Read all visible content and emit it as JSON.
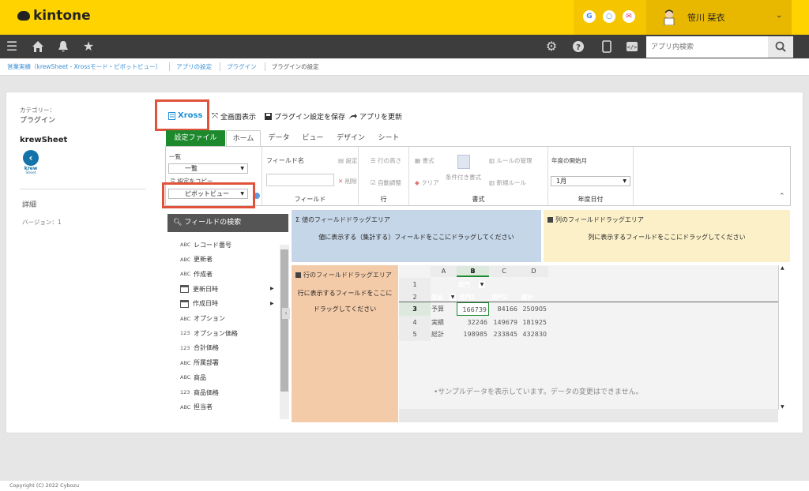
{
  "header": {
    "logo_text": "kintone",
    "user_name": "笹川 栞衣",
    "quick_icons": [
      {
        "icon": "google-icon",
        "glyph": "G",
        "color": "#4285f4"
      },
      {
        "icon": "circle-app-icon",
        "glyph": "○",
        "color": "#2d8ee0"
      },
      {
        "icon": "mail-icon",
        "glyph": "✉",
        "color": "#e0457a"
      }
    ]
  },
  "navbar": {
    "search_placeholder": "アプリ内検索"
  },
  "breadcrumb": {
    "items": [
      "営業実績（krewSheet - Xrossモード・ピボットビュー）",
      "アプリの設定",
      "プラグイン",
      "プラグインの設定"
    ]
  },
  "left_info": {
    "category_label": "カテゴリー：",
    "category_value": "プラグイン",
    "app_name": "krewSheet",
    "logo_text": "krew",
    "logo_sub": "Sheet",
    "detail": "詳細",
    "version": "バージョン：1"
  },
  "toolbar": {
    "xross": "Xross",
    "fullscreen": "全画面表示",
    "save": "プラグイン設定を保存",
    "update_app": "アプリを更新"
  },
  "ribbon_tabs": {
    "file": "設定ファイル",
    "tabs": [
      "ホーム",
      "データ",
      "ビュー",
      "デザイン",
      "シート"
    ]
  },
  "ribbon": {
    "list_label": "一覧",
    "list_select": "一覧",
    "copy_settings": "設定をコピー",
    "view_select": "ピボットビュー",
    "field_name_label": "フィールド名",
    "btn_settings": "設定",
    "btn_delete": "削除",
    "group_field": "フィールド",
    "btn_row_height": "行の高さ",
    "btn_auto_adjust": "自動調整",
    "group_row": "行",
    "btn_format": "書式",
    "btn_clear": "クリア",
    "btn_cond_format": "条件付き書式",
    "btn_rule_manage": "ルールの管理",
    "btn_new_rule": "新規ルール",
    "group_format": "書式",
    "fiscal_label": "年度の開始月",
    "fiscal_select": "1月",
    "group_fiscal": "年度日付"
  },
  "field_panel": {
    "search": "フィールドの検索",
    "fields": [
      {
        "type": "ABC",
        "name": "レコード番号",
        "expand": false
      },
      {
        "type": "ABC",
        "name": "更新者",
        "expand": false
      },
      {
        "type": "ABC",
        "name": "作成者",
        "expand": false
      },
      {
        "type": "calendar",
        "name": "更新日時",
        "expand": true
      },
      {
        "type": "calendar",
        "name": "作成日時",
        "expand": true
      },
      {
        "type": "ABC",
        "name": "オプション",
        "expand": false
      },
      {
        "type": "123",
        "name": "オプション価格",
        "expand": false
      },
      {
        "type": "123",
        "name": "合計価格",
        "expand": false
      },
      {
        "type": "ABC",
        "name": "所属部署",
        "expand": false
      },
      {
        "type": "ABC",
        "name": "商品",
        "expand": false
      },
      {
        "type": "123",
        "name": "商品価格",
        "expand": false
      },
      {
        "type": "ABC",
        "name": "担当者",
        "expand": false
      }
    ]
  },
  "drag_areas": {
    "value_title": "値のフィールドドラッグエリア",
    "value_desc": "値に表示する（集計する）フィールドをここにドラッグしてください",
    "column_title": "列のフィールドドラッグエリア",
    "column_desc": "列に表示するフィールドをここにドラッグしてください",
    "row_title": "行のフィールドドラッグエリア",
    "row_desc_1": "行に表示するフィールドをここに",
    "row_desc_2": "ドラッグしてください"
  },
  "sheet": {
    "columns": [
      "A",
      "B",
      "C",
      "D"
    ],
    "rows": [
      "1",
      "2",
      "3",
      "4",
      "5"
    ],
    "header_row1": "部門",
    "header_row2": [
      "部品",
      "部門1",
      "部門2",
      "総計"
    ],
    "data": [
      {
        "label": "予算",
        "values": [
          "166739",
          "84166",
          "250905"
        ]
      },
      {
        "label": "実績",
        "values": [
          "32246",
          "149679",
          "181925"
        ]
      },
      {
        "label": "総計",
        "values": [
          "198985",
          "233845",
          "432830"
        ]
      }
    ],
    "note": "•サンプルデータを表示しています。データの変更はできません。",
    "accent": "#1c8a2c"
  },
  "footer": {
    "copyright": "Copyright (C) 2022 Cybozu"
  }
}
